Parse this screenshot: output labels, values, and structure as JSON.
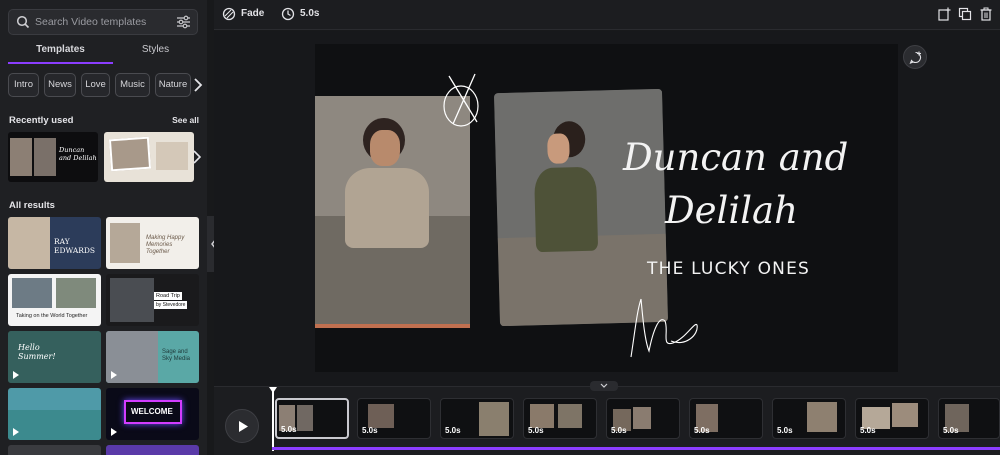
{
  "sidebar": {
    "search_placeholder": "Search Video templates",
    "tabs": [
      "Templates",
      "Styles"
    ],
    "chips": [
      "Intro",
      "News",
      "Love",
      "Music",
      "Nature"
    ],
    "recently_used": {
      "title": "Recently used",
      "see_all": "See all"
    },
    "all_results": {
      "title": "All results"
    },
    "thumb_texts": {
      "ray": "RAY EDWARDS",
      "happy": "Making Happy Memories Together",
      "world": "Taking on the World Together",
      "road": "Road Trip",
      "road2": "by Stevedore",
      "hello": "Hello Summer!",
      "sage": "Sage and Sky Media",
      "welcome": "WELCOME",
      "recent1": "Duncan and Delilah"
    }
  },
  "topbar": {
    "transition_label": "Fade",
    "duration_label": "5.0s"
  },
  "canvas": {
    "title_line1": "Duncan and",
    "title_line2": "Delilah",
    "subtitle": "THE LUCKY ONES"
  },
  "timeline": {
    "clips": [
      "5.0s",
      "5.0s",
      "5.0s",
      "5.0s",
      "5.0s",
      "5.0s",
      "5.0s",
      "5.0s",
      "5.0s"
    ]
  },
  "colors": {
    "accent": "#8b3dff",
    "background": "#18191b",
    "panel": "#1f2023"
  },
  "icons": [
    "search-icon",
    "filter-icon",
    "chevron-right-icon",
    "fade-icon",
    "clock-icon",
    "add-page-icon",
    "duplicate-icon",
    "trash-icon",
    "comment-add-icon",
    "play-icon",
    "chevron-down-icon",
    "chevron-left-icon"
  ]
}
